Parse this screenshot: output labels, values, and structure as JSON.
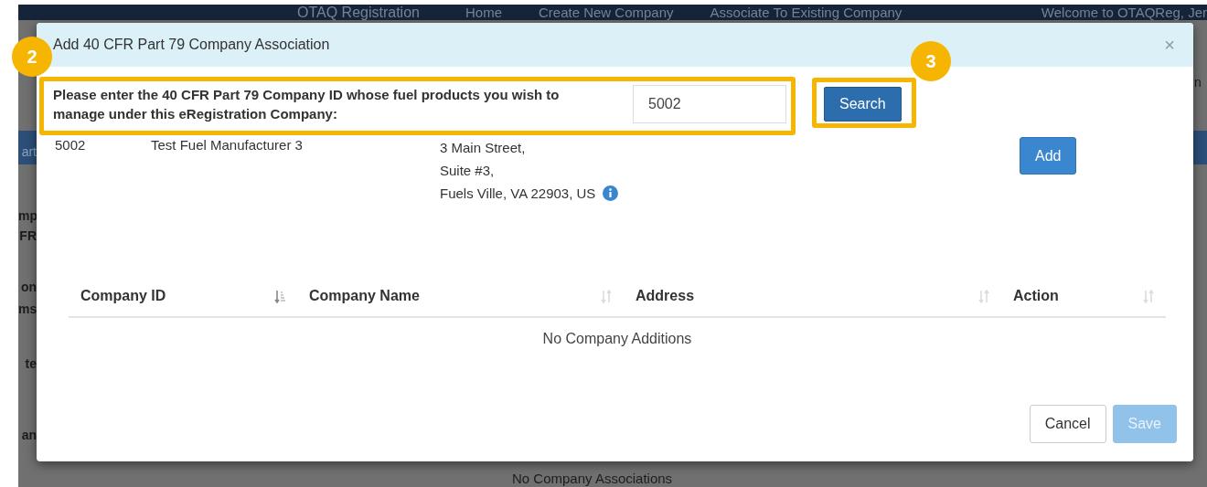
{
  "background_page": {
    "nav": {
      "brand": "OTAQ Registration",
      "links": [
        "Home",
        "Create New Company",
        "Associate To Existing Company"
      ],
      "welcome": "Welcome to OTAQReg, Jer"
    },
    "side_fragments": [
      "art",
      "mp",
      "FR",
      "on",
      "ms",
      "te",
      "an"
    ],
    "right_fragment": "n",
    "empty_message": "No Company Associations"
  },
  "modal": {
    "title": "Add 40 CFR Part 79 Company Association",
    "close": "×",
    "search_label": "Please enter the 40 CFR Part 79 Company ID whose fuel products you wish to manage under this eRegistration Company:",
    "company_id_input": {
      "value": "5002"
    },
    "search_button": "Search",
    "result": {
      "company_id": "5002",
      "company_name": "Test Fuel Manufacturer 3",
      "address_lines": [
        "3 Main Street,",
        "Suite #3,",
        "Fuels Ville, VA 22903, US"
      ],
      "add_button": "Add"
    },
    "table": {
      "columns": [
        {
          "label": "Company ID",
          "sorted": true
        },
        {
          "label": "Company Name",
          "sorted": false
        },
        {
          "label": "Address",
          "sorted": false
        },
        {
          "label": "Action",
          "sorted": false
        }
      ],
      "empty_message": "No Company Additions"
    },
    "buttons": [
      {
        "label": "Cancel",
        "kind": "default",
        "disabled": false
      },
      {
        "label": "Save",
        "kind": "primary",
        "disabled": true
      }
    ]
  },
  "annotations": [
    {
      "number": "2"
    },
    {
      "number": "3"
    }
  ]
}
